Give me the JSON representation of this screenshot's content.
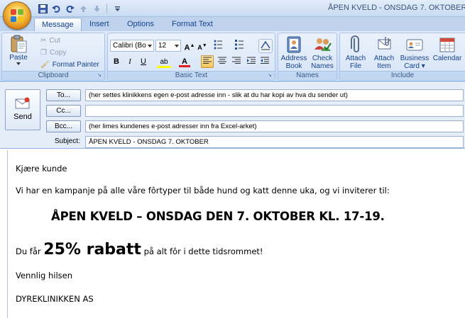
{
  "titlebar": {
    "title": "ÅPEN KVELD  -  ONSDAG 7. OKTOBER"
  },
  "tabs": [
    {
      "label": "Message",
      "active": true
    },
    {
      "label": "Insert",
      "active": false
    },
    {
      "label": "Options",
      "active": false
    },
    {
      "label": "Format Text",
      "active": false
    }
  ],
  "ribbon": {
    "clipboard": {
      "label": "Clipboard",
      "paste": "Paste",
      "cut": "Cut",
      "copy": "Copy",
      "format_painter": "Format Painter"
    },
    "basic_text": {
      "label": "Basic Text",
      "font": "Calibri (Bo",
      "size": "12"
    },
    "names": {
      "label": "Names",
      "address_book": [
        "Address",
        "Book"
      ],
      "check_names": [
        "Check",
        "Names"
      ]
    },
    "include": {
      "label": "Include",
      "attach_file": [
        "Attach",
        "File"
      ],
      "attach_item": [
        "Attach",
        "Item"
      ],
      "business_card": [
        "Business",
        "Card"
      ],
      "calendar": "Calendar"
    }
  },
  "header": {
    "send": "Send",
    "to_button": "To...",
    "cc_button": "Cc...",
    "bcc_button": "Bcc...",
    "subject_label": "Subject:",
    "to_value": "(her settes klinikkens egen e-post adresse inn - slik at du har kopi av hva du sender ut)",
    "cc_value": "",
    "bcc_value": "(her limes kundenes e-post adresser inn fra Excel-arket)",
    "subject_value": "ÅPEN KVELD  - ONSDAG 7. OKTOBER"
  },
  "body": {
    "greeting": "Kjære kunde",
    "intro": "Vi har en kampanje på alle våre fôrtyper til både hund og katt denne uka, og vi inviterer til:",
    "headline": "ÅPEN KVELD – ONSDAG DEN 7. OKTOBER KL. 17-19.",
    "discount_prefix": "Du får ",
    "discount_big": "25% rabatt",
    "discount_suffix": " på alt fôr  i dette tidsrommet!",
    "closing": "Vennlig hilsen",
    "signature": "DYREKLINIKKEN AS"
  },
  "colors": {
    "ribbon_text": "#15428b",
    "highlight": "#ffff00",
    "font_color": "#e02020"
  }
}
